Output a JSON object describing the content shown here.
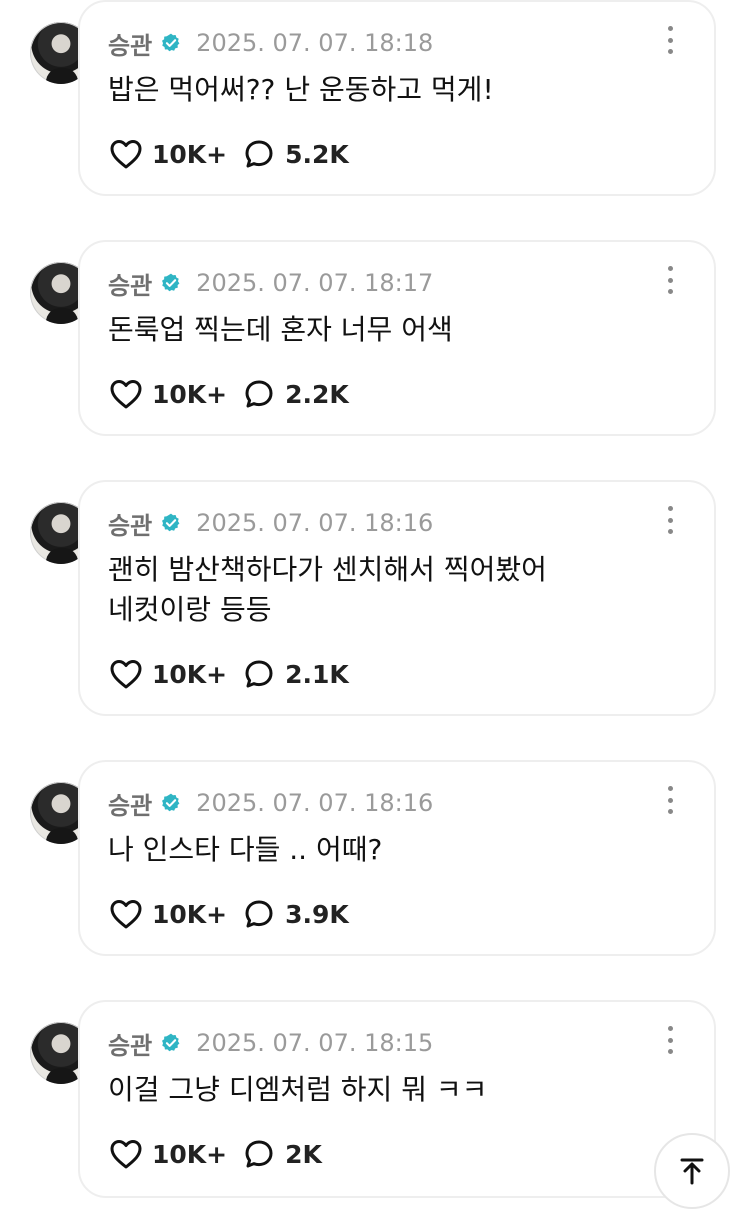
{
  "posts": [
    {
      "author": "승관",
      "timestamp": "2025. 07. 07. 18:18",
      "text": "밥은 먹어써?? 난 운동하고 먹게!",
      "likes": "10K+",
      "comments": "5.2K"
    },
    {
      "author": "승관",
      "timestamp": "2025. 07. 07. 18:17",
      "text": "돈룩업 찍는데 혼자 너무 어색",
      "likes": "10K+",
      "comments": "2.2K"
    },
    {
      "author": "승관",
      "timestamp": "2025. 07. 07. 18:16",
      "text": "괜히 밤산책하다가 센치해서 찍어봤어\n네컷이랑 등등",
      "likes": "10K+",
      "comments": "2.1K"
    },
    {
      "author": "승관",
      "timestamp": "2025. 07. 07. 18:16",
      "text": "나 인스타 다들 .. 어때?",
      "likes": "10K+",
      "comments": "3.9K"
    },
    {
      "author": "승관",
      "timestamp": "2025. 07. 07. 18:15",
      "text": "이걸 그냥 디엠처럼 하지 뭐 ㅋㅋ",
      "likes": "10K+",
      "comments": "2K"
    }
  ],
  "icons": {
    "verified": "verified-badge-icon",
    "more": "more-vertical-icon",
    "like": "heart-icon",
    "comment": "comment-bubble-icon",
    "scroll_top": "arrow-up-icon"
  },
  "colors": {
    "verified_badge": "#2fb5c4",
    "bubble_border": "#eeeeee",
    "timestamp": "#9a9a9a",
    "author": "#6f6f6f"
  }
}
